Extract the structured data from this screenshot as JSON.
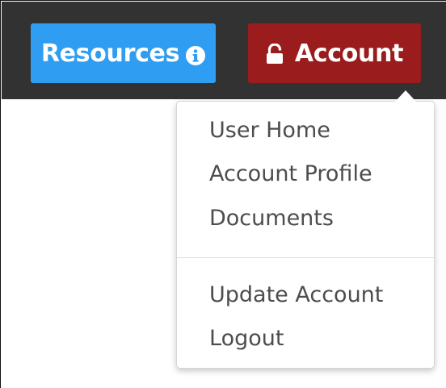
{
  "navbar": {
    "resources_button": {
      "label": "Resources",
      "icon": "info-icon",
      "color": "#2f9ef2"
    },
    "account_button": {
      "label": "Account",
      "icon": "unlock-icon",
      "color": "#9b1c1c"
    },
    "background": "#323232"
  },
  "account_menu": {
    "items": [
      {
        "label": "User Home"
      },
      {
        "label": "Account Profile"
      },
      {
        "label": "Documents"
      },
      {
        "label": "Update Account"
      },
      {
        "label": "Logout"
      }
    ]
  }
}
